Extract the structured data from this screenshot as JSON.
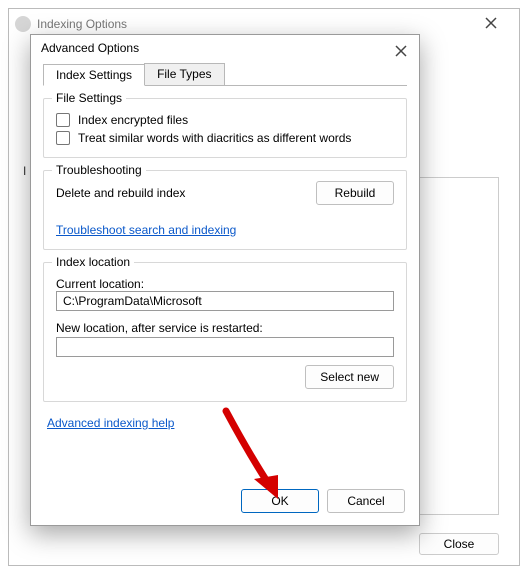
{
  "parentWindow": {
    "title": "Indexing Options",
    "closeButton": "Close"
  },
  "dialog": {
    "title": "Advanced Options",
    "tabs": [
      {
        "label": "Index Settings"
      },
      {
        "label": "File Types"
      }
    ],
    "fileSettings": {
      "title": "File Settings",
      "indexEncrypted": "Index encrypted files",
      "treatDiacritics": "Treat similar words with diacritics as different words"
    },
    "troubleshooting": {
      "title": "Troubleshooting",
      "deleteRebuild": "Delete and rebuild index",
      "rebuildButton": "Rebuild",
      "link": "Troubleshoot search and indexing"
    },
    "indexLocation": {
      "title": "Index location",
      "currentLabel": "Current location:",
      "currentValue": "C:\\ProgramData\\Microsoft",
      "newLabel": "New location, after service is restarted:",
      "newValue": "",
      "selectNew": "Select new"
    },
    "helpLink": "Advanced indexing help",
    "buttons": {
      "ok": "OK",
      "cancel": "Cancel"
    }
  }
}
